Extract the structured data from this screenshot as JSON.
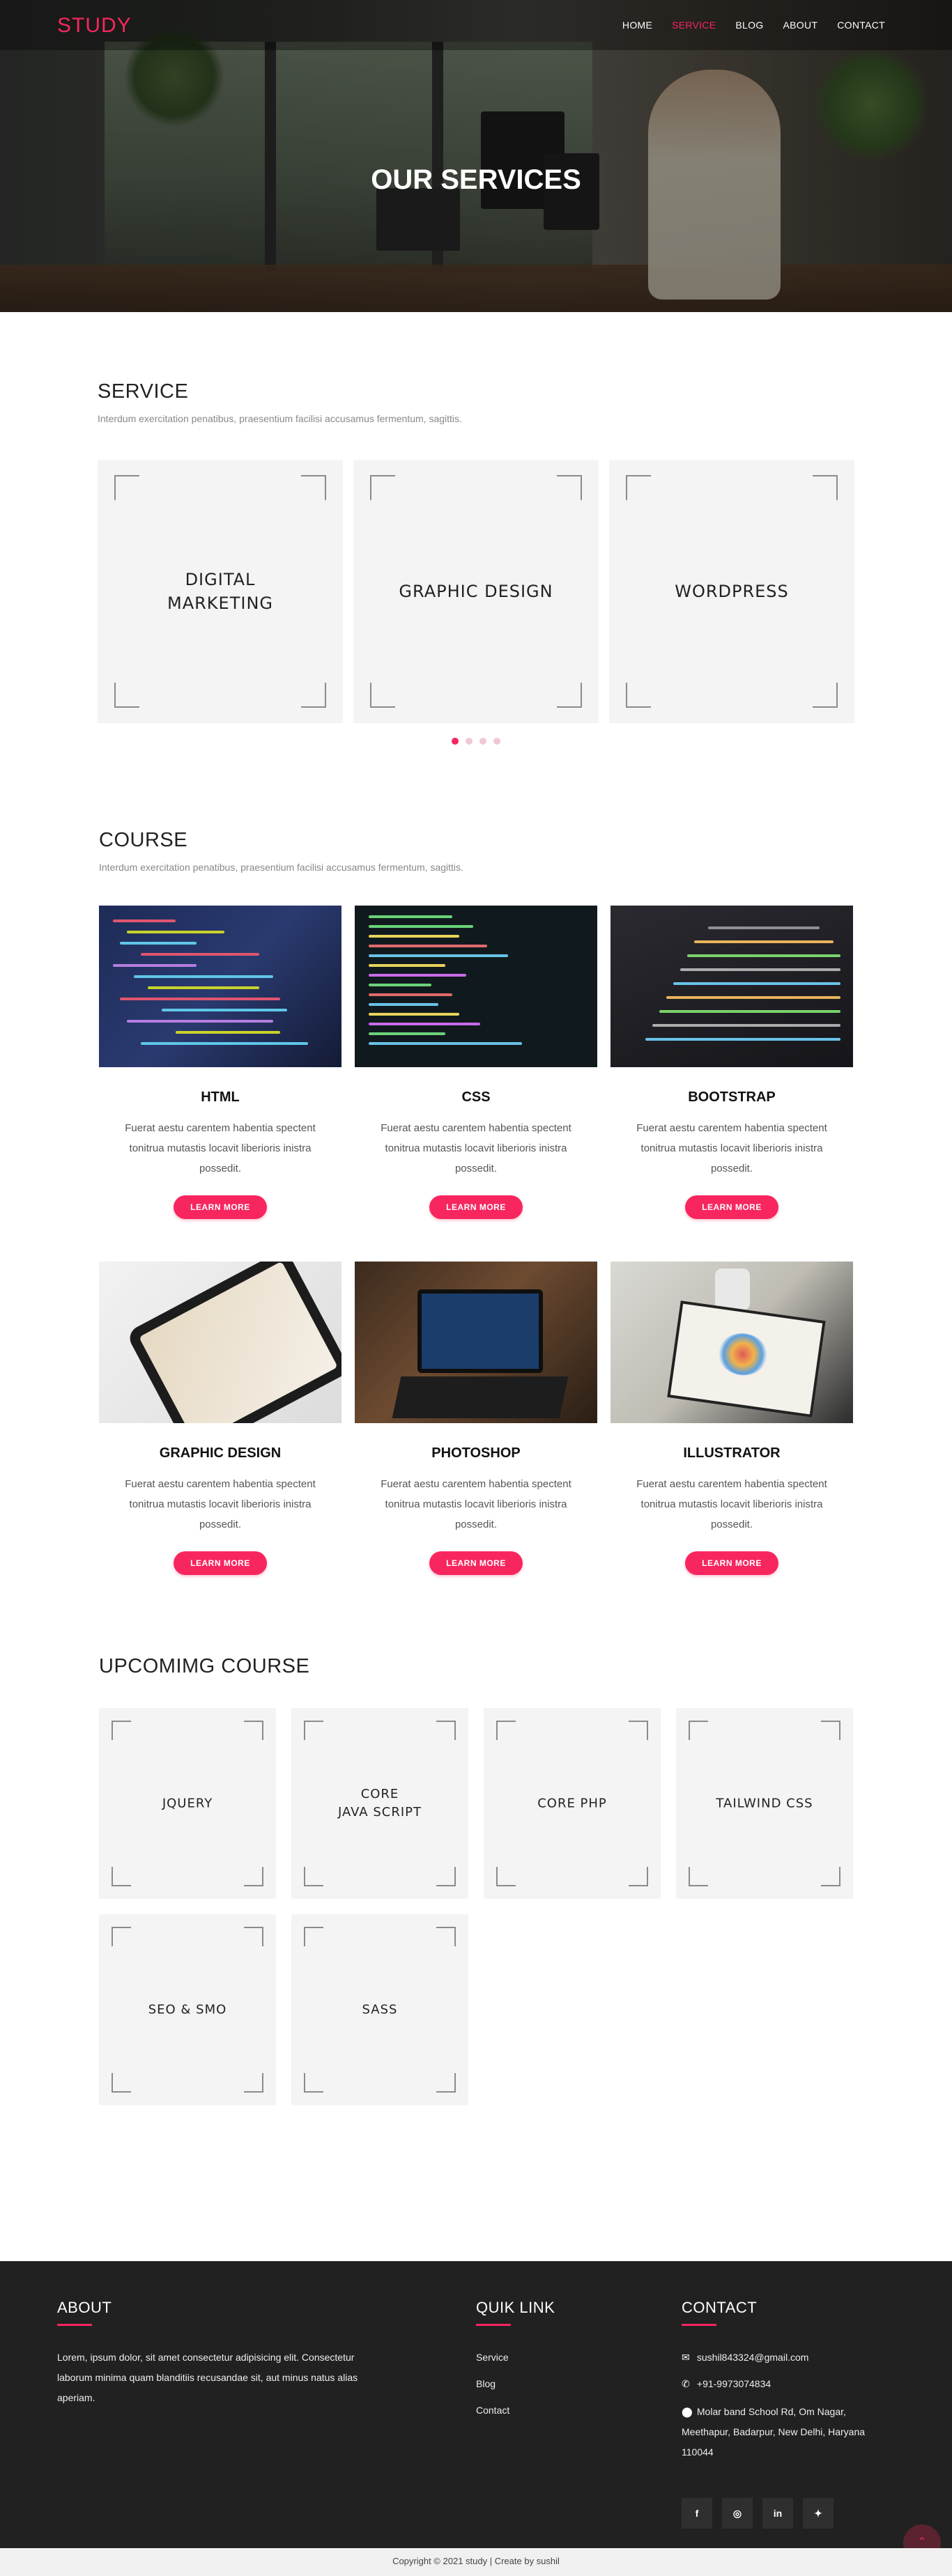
{
  "brand": {
    "logo": "STUDY",
    "accent": "#f7265f"
  },
  "nav": [
    {
      "label": "HOME",
      "active": false
    },
    {
      "label": "SERVICE",
      "active": true
    },
    {
      "label": "BLOG",
      "active": false
    },
    {
      "label": "ABOUT",
      "active": false
    },
    {
      "label": "CONTACT",
      "active": false
    }
  ],
  "hero": {
    "title": "OUR SERVICES"
  },
  "service": {
    "title": "SERVICE",
    "subtitle": "Interdum exercitation penatibus, praesentium facilisi accusamus fermentum, sagittis.",
    "cards": [
      "DIGITAL\nMARKETING",
      "GRAPHIC DESIGN",
      "WORDPRESS"
    ],
    "carousel_pages": 4,
    "carousel_active": 1
  },
  "course": {
    "title": "COURSE",
    "subtitle": "Interdum exercitation penatibus, praesentium facilisi accusamus fermentum, sagittis.",
    "items": [
      {
        "title": "HTML",
        "desc": "Fuerat aestu carentem habentia spectent tonitrua mutastis locavit liberioris inistra possedit.",
        "button": "LEARN MORE",
        "image": "html-code-image"
      },
      {
        "title": "CSS",
        "desc": "Fuerat aestu carentem habentia spectent tonitrua mutastis locavit liberioris inistra possedit.",
        "button": "LEARN MORE",
        "image": "css-code-image"
      },
      {
        "title": "BOOTSTRAP",
        "desc": "Fuerat aestu carentem habentia spectent tonitrua mutastis locavit liberioris inistra possedit.",
        "button": "LEARN MORE",
        "image": "bootstrap-code-image"
      },
      {
        "title": "GRAPHIC DESIGN",
        "desc": "Fuerat aestu carentem habentia spectent tonitrua mutastis locavit liberioris inistra possedit.",
        "button": "LEARN MORE",
        "image": "tablet-design-image"
      },
      {
        "title": "PHOTOSHOP",
        "desc": "Fuerat aestu carentem habentia spectent tonitrua mutastis locavit liberioris inistra possedit.",
        "button": "LEARN MORE",
        "image": "laptop-photoshop-image"
      },
      {
        "title": "ILLUSTRATOR",
        "desc": "Fuerat aestu carentem habentia spectent tonitrua mutastis locavit liberioris inistra possedit.",
        "button": "LEARN MORE",
        "image": "drawing-tablet-image"
      }
    ]
  },
  "upcoming": {
    "title": "UPCOMIMG COURSE",
    "cards": [
      "JQUERY",
      "CORE\nJAVA SCRIPT",
      "CORE PHP",
      "TAILWIND CSS",
      "SEO & SMO",
      "SASS"
    ]
  },
  "footer": {
    "about_title": "ABOUT",
    "about_text": "Lorem, ipsum dolor, sit amet consectetur adipisicing elit. Consectetur laborum minima quam blanditiis recusandae sit, aut minus natus alias aperiam.",
    "links_title": "QUIK LINK",
    "links": [
      "Service",
      "Blog",
      "Contact"
    ],
    "contact_title": "CONTACT",
    "email": "sushil843324@gmail.com",
    "phone": "+91-9973074834",
    "address": "Molar band School Rd, Om Nagar, Meethapur, Badarpur, New Delhi, Haryana 110044",
    "social": [
      "facebook-icon",
      "instagram-icon",
      "linkedin-icon",
      "twitter-icon"
    ],
    "copyright": "Copyright © 2021 study | Create by sushil"
  }
}
